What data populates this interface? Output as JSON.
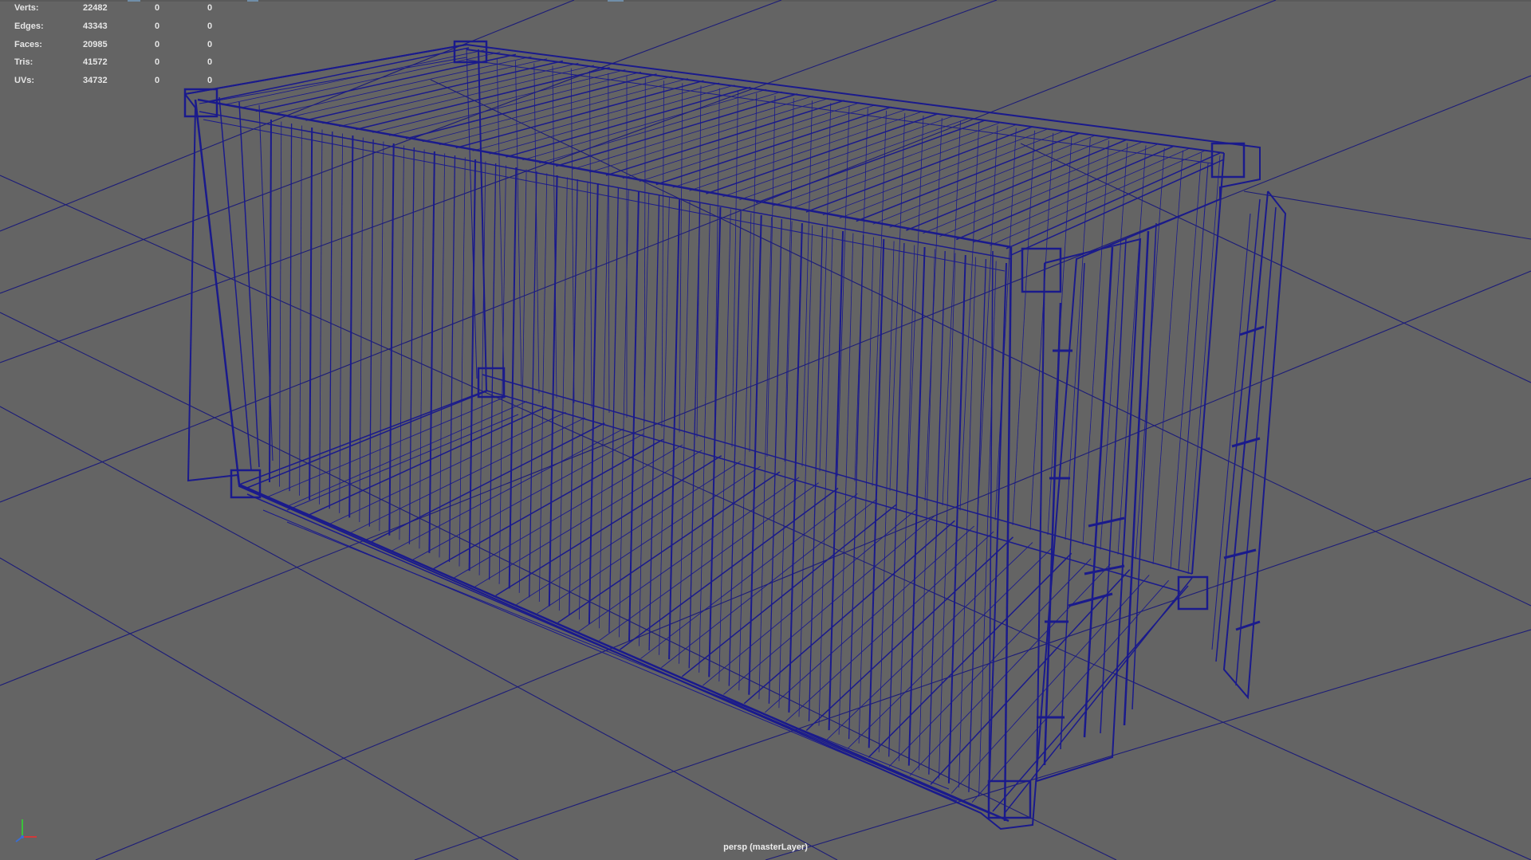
{
  "hud": {
    "rows": [
      {
        "label": "Verts:",
        "total": "22482",
        "selected": "0",
        "components": "0"
      },
      {
        "label": "Edges:",
        "total": "43343",
        "selected": "0",
        "components": "0"
      },
      {
        "label": "Faces:",
        "total": "20985",
        "selected": "0",
        "components": "0"
      },
      {
        "label": "Tris:",
        "total": "41572",
        "selected": "0",
        "components": "0"
      },
      {
        "label": "UVs:",
        "total": "34732",
        "selected": "0",
        "components": "0"
      }
    ]
  },
  "viewport": {
    "camera_label": "persp (masterLayer)",
    "background_color": "#646464",
    "grid_color": "#1c1c78",
    "wireframe_color": "#1a1a8c",
    "display_mode": "wireframe",
    "object": "shipping container (20ft) with open rear doors"
  },
  "axis_gizmo": {
    "icon": "view-axis-icon",
    "colors": {
      "x": "#d23a3a",
      "y": "#3ac23a",
      "z": "#3a6ed2"
    }
  }
}
